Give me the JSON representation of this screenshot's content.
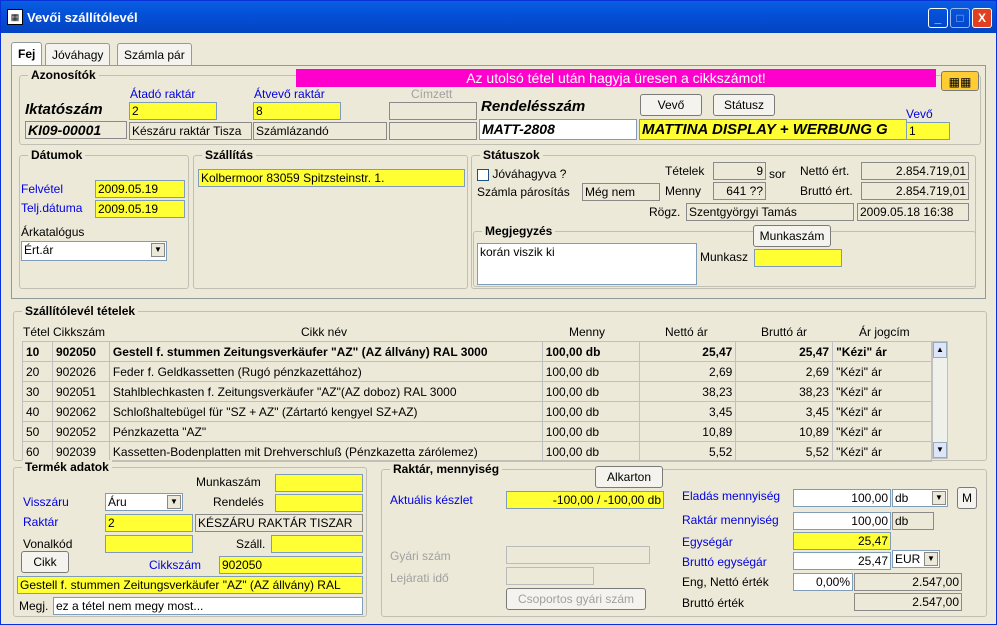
{
  "window": {
    "title": "Vevői szállítólevél",
    "min": "_",
    "max": "□",
    "close": "X"
  },
  "tabs": [
    "Fej",
    "Jóváhagy",
    "Számla pár"
  ],
  "azon": {
    "title": "Azonosítók",
    "banner": "Az utolsó tétel után hagyja üresen a cikkszámot!",
    "iktato_label": "Iktatószám",
    "iktato_value": "KI09-00001",
    "atado_label": "Átadó raktár",
    "atado_value": "2",
    "atado_name": "Készáru raktár Tisza",
    "atvevo_label": "Átvevő raktár",
    "atvevo_value": "8",
    "atvevo_name": "Számlázandó",
    "cimzett_label": "Címzett",
    "rendeles_label": "Rendelésszám",
    "rendeles_value": "MATT-2808",
    "vevo_btn": "Vevő",
    "status_btn": "Státusz",
    "customer_name": "MATTINA DISPLAY + WERBUNG G",
    "vevo_label": "Vevő",
    "vevo_value": "1"
  },
  "datumok": {
    "title": "Dátumok",
    "felvetel_label": "Felvétel",
    "felvetel_value": "2009.05.19",
    "telj_label": "Telj.dátuma",
    "telj_value": "2009.05.19",
    "arkat_label": "Árkatalógus",
    "arkat_value": "Ért.ár"
  },
  "szallitas": {
    "title": "Szállítás",
    "value": "Kolbermoor 83059 Spitzsteinstr. 1."
  },
  "statusz": {
    "title": "Státuszok",
    "jovahagyva": "Jóváhagyva ?",
    "szamla_label": "Számla párosítás",
    "szamla_value": "Még nem",
    "tetelek_label": "Tételek",
    "tetelek_value": "9",
    "sor": "sor",
    "menny_label": "Menny",
    "menny_value": "641 ??",
    "netto_label": "Nettó ért.",
    "netto_value": "2.854.719,01",
    "brutto_label": "Bruttó ért.",
    "brutto_value": "2.854.719,01",
    "rogz_label": "Rögz.",
    "rogz_user": "Szentgyörgyi Tamás",
    "rogz_time": "2009.05.18 16:38"
  },
  "megj": {
    "title": "Megjegyzés",
    "value": "korán viszik ki",
    "munkaszam_btn": "Munkaszám",
    "munkasz_label": "Munkasz"
  },
  "tetelek": {
    "title": "Szállítólevél tételek",
    "headers": [
      "Tétel",
      "Cikkszám",
      "Cikk név",
      "Menny",
      "Nettó ár",
      "Bruttó ár",
      "Ár jogcím"
    ],
    "rows": [
      [
        "10",
        "902050",
        "Gestell f. stummen Zeitungsverkäufer \"AZ\" (AZ állvány) RAL 3000",
        "100,00 db",
        "25,47",
        "25,47",
        "\"Kézi\" ár"
      ],
      [
        "20",
        "902026",
        "Feder f. Geldkassetten (Rugó pénzkazettához)",
        "100,00 db",
        "2,69",
        "2,69",
        "\"Kézi\" ár"
      ],
      [
        "30",
        "902051",
        "Stahlblechkasten f. Zeitungsverkäufer \"AZ\"(AZ doboz) RAL 3000",
        "100,00 db",
        "38,23",
        "38,23",
        "\"Kézi\" ár"
      ],
      [
        "40",
        "902062",
        "Schloßhaltebügel für \"SZ + AZ\" (Zártartó kengyel SZ+AZ)",
        "100,00 db",
        "3,45",
        "3,45",
        "\"Kézi\" ár"
      ],
      [
        "50",
        "902052",
        "Pénzkazetta \"AZ\"",
        "100,00 db",
        "10,89",
        "10,89",
        "\"Kézi\" ár"
      ],
      [
        "60",
        "902039",
        "Kassetten-Bodenplatten mit Drehverschluß (Pénzkazetta zárólemez)",
        "100,00 db",
        "5,52",
        "5,52",
        "\"Kézi\" ár"
      ]
    ]
  },
  "termek": {
    "title": "Termék adatok",
    "munkaszam_label": "Munkaszám",
    "visszaru_label": "Visszáru",
    "visszaru_value": "Áru",
    "rendeles_label": "Rendelés",
    "raktar_label": "Raktár",
    "raktar_value": "2",
    "raktar_name": "KÉSZÁRU RAKTÁR TISZAR",
    "vonalkod_label": "Vonalkód",
    "szall_label": "Száll.",
    "cikk_btn": "Cikk",
    "cikkszam_label": "Cikkszám",
    "cikkszam_value": "902050",
    "cikk_name": "Gestell f. stummen Zeitungsverkäufer \"AZ\" (AZ állvány) RAL",
    "megj_label": "Megj.",
    "megj_value": "ez a tétel nem megy most..."
  },
  "raktar": {
    "title": "Raktár, mennyiség",
    "alkarton_btn": "Alkarton",
    "aktualis_label": "Aktuális készlet",
    "aktualis_value": "-100,00 / -100,00 db",
    "gyari_label": "Gyári szám",
    "lejarati_label": "Lejárati idő",
    "csoportos_btn": "Csoportos gyári szám",
    "eladas_label": "Eladás mennyiség",
    "eladas_value": "100,00",
    "eladas_unit": "db",
    "m_btn": "M",
    "raktar_m_label": "Raktár mennyiség",
    "raktar_m_value": "100,00",
    "raktar_m_unit": "db",
    "egysegar_label": "Egységár",
    "egysegar_value": "25,47",
    "brutto_egys_label": "Bruttó egységár",
    "brutto_egys_value": "25,47",
    "currency": "EUR",
    "eng_label": "Eng, Nettó érték",
    "eng_pct": "0,00%",
    "eng_value": "2.547,00",
    "brutto_ertek_label": "Bruttó érték",
    "brutto_ertek_value": "2.547,00"
  }
}
